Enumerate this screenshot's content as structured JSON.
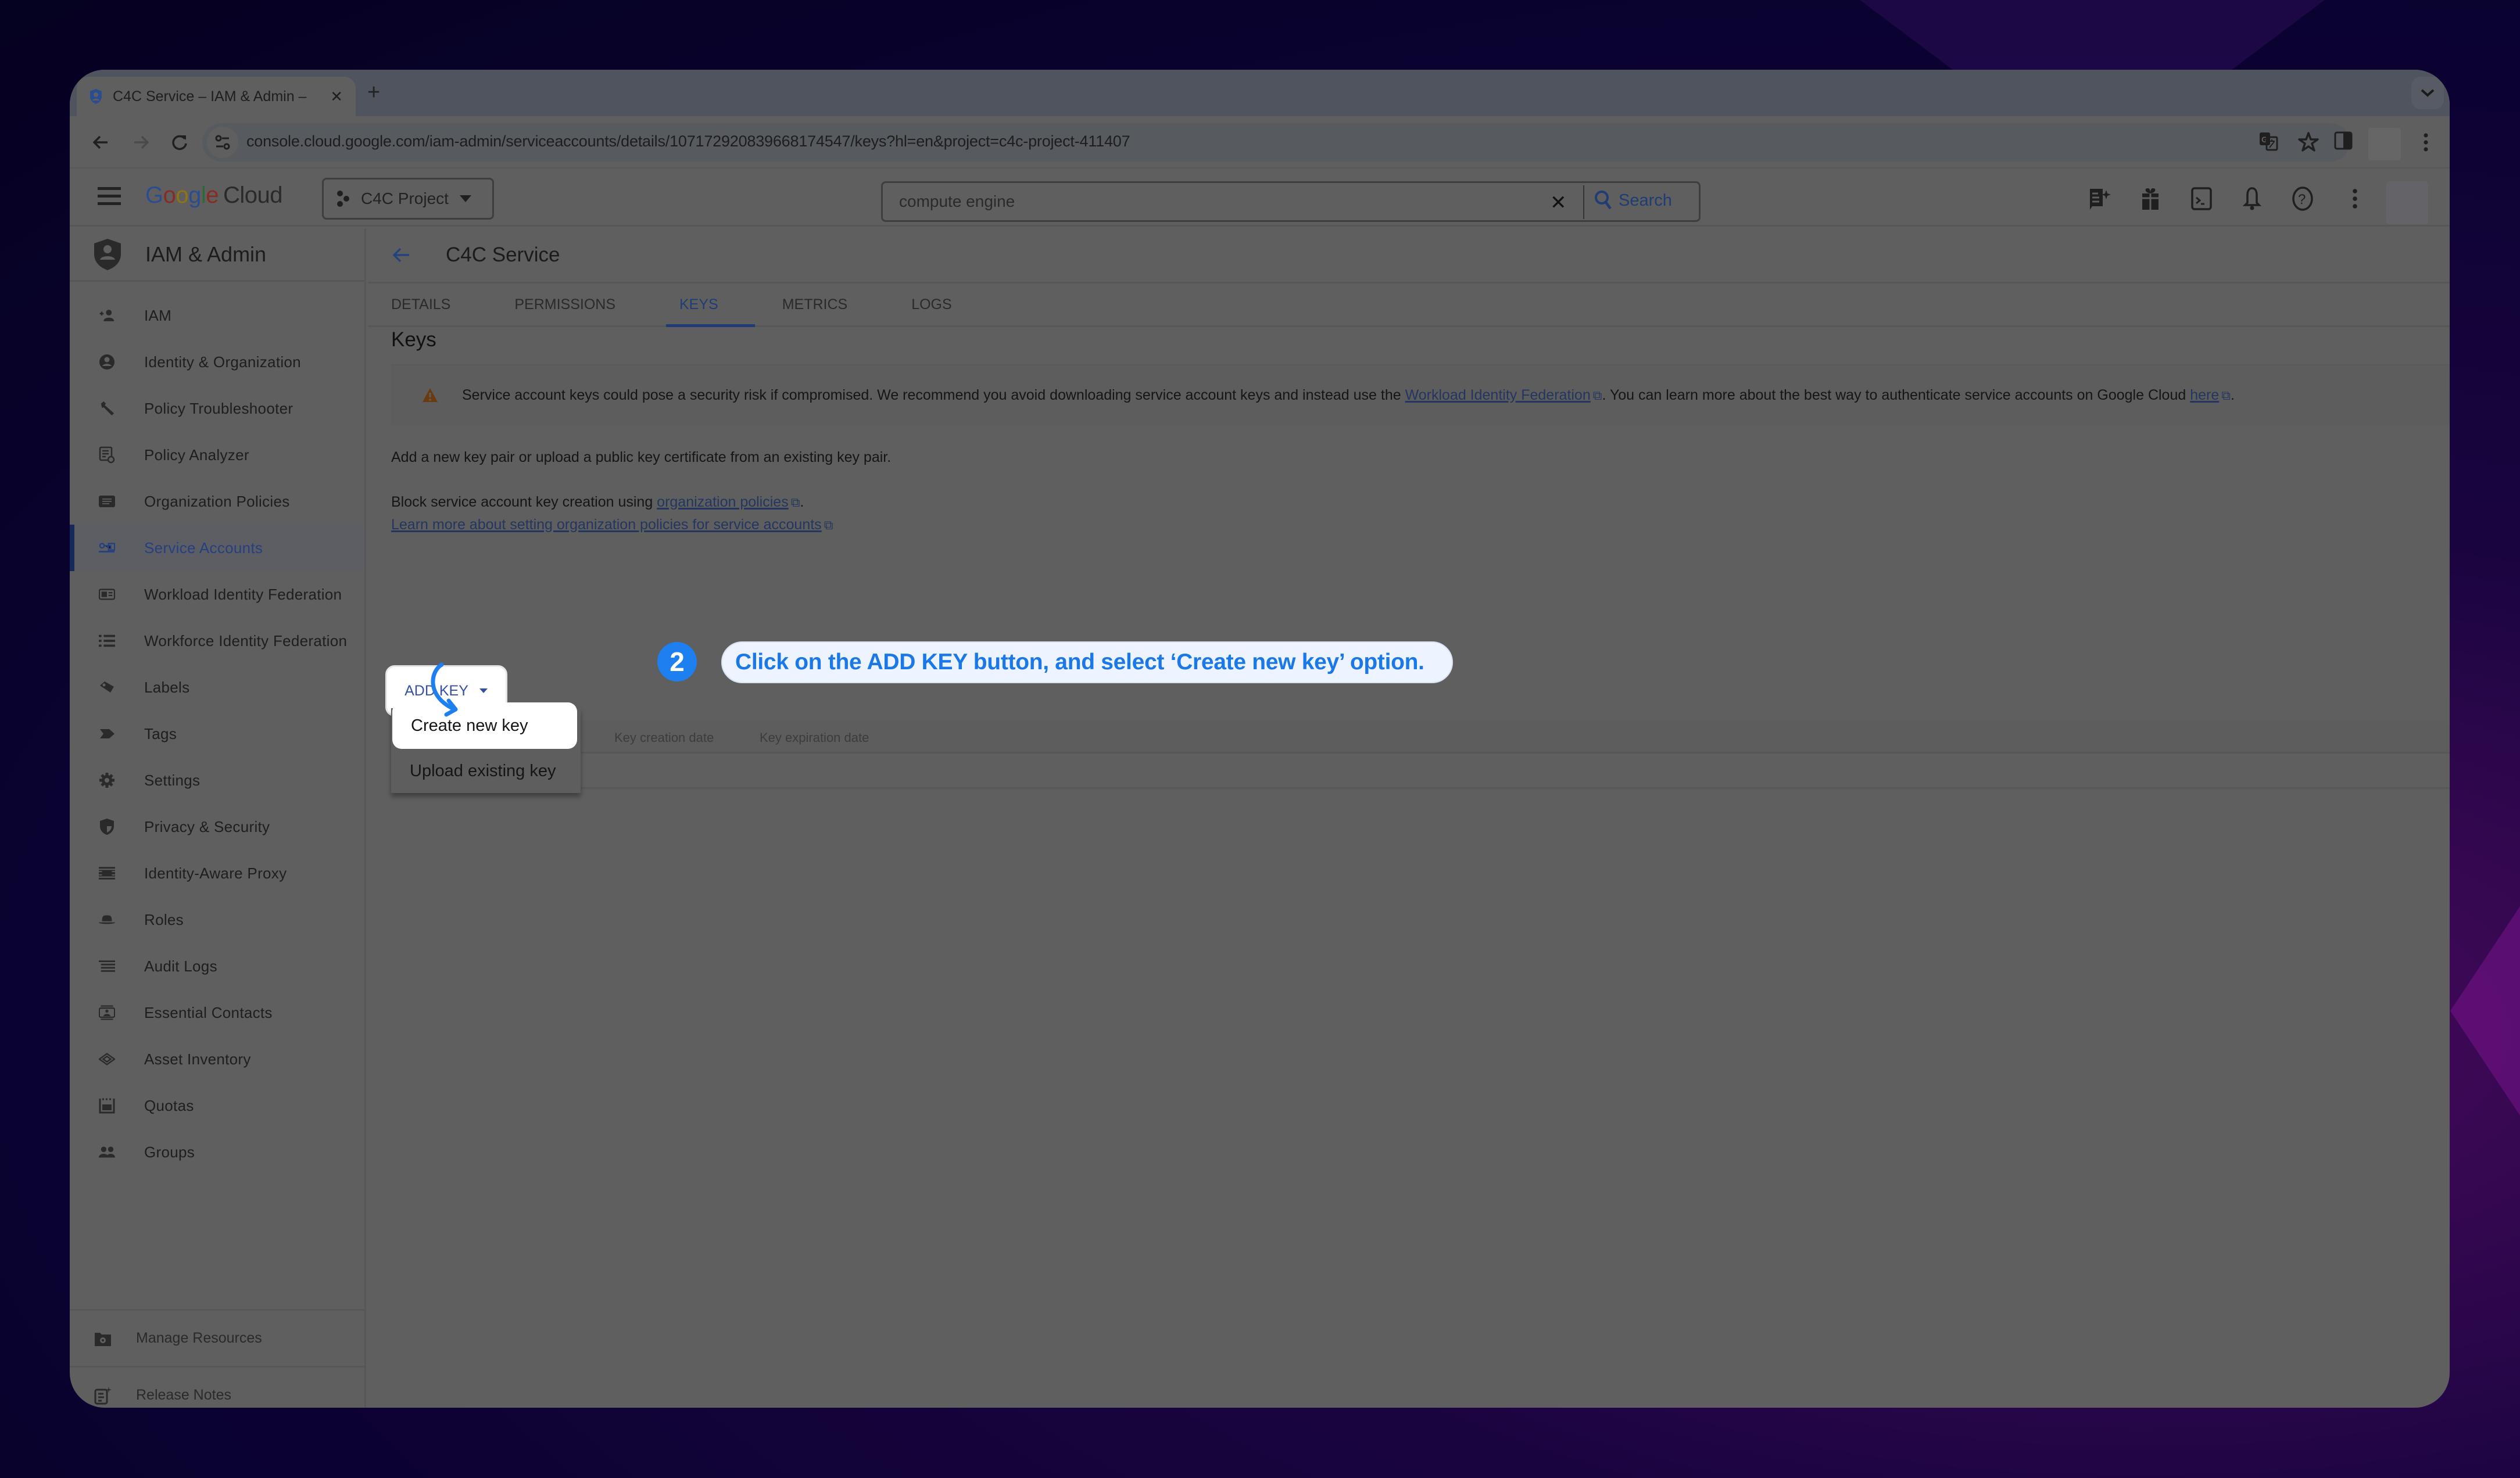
{
  "browser": {
    "tab_title": "C4C Service – IAM & Admin –",
    "url": "console.cloud.google.com/iam-admin/serviceaccounts/details/107172920839668174547/keys?hl=en&project=c4c-project-411407"
  },
  "header": {
    "logo_google": [
      "G",
      "o",
      "o",
      "g",
      "l",
      "e"
    ],
    "logo_cloud": "Cloud",
    "project": "C4C Project",
    "search_value": "compute engine",
    "search_button": "Search"
  },
  "sidebar": {
    "title": "IAM & Admin",
    "items": [
      {
        "label": "IAM",
        "icon": "person-add-icon"
      },
      {
        "label": "Identity & Organization",
        "icon": "account-circle-icon"
      },
      {
        "label": "Policy Troubleshooter",
        "icon": "wrench-icon"
      },
      {
        "label": "Policy Analyzer",
        "icon": "policy-analyzer-icon"
      },
      {
        "label": "Organization Policies",
        "icon": "org-policy-icon"
      },
      {
        "label": "Service Accounts",
        "icon": "service-account-key-icon",
        "active": true
      },
      {
        "label": "Workload Identity Federation",
        "icon": "id-card-icon"
      },
      {
        "label": "Workforce Identity Federation",
        "icon": "list-icon"
      },
      {
        "label": "Labels",
        "icon": "label-icon"
      },
      {
        "label": "Tags",
        "icon": "tag-icon"
      },
      {
        "label": "Settings",
        "icon": "gear-icon"
      },
      {
        "label": "Privacy & Security",
        "icon": "shield-icon"
      },
      {
        "label": "Identity-Aware Proxy",
        "icon": "proxy-icon"
      },
      {
        "label": "Roles",
        "icon": "hat-icon"
      },
      {
        "label": "Audit Logs",
        "icon": "audit-lines-icon"
      },
      {
        "label": "Essential Contacts",
        "icon": "contact-icon"
      },
      {
        "label": "Asset Inventory",
        "icon": "layers-icon"
      },
      {
        "label": "Quotas",
        "icon": "quota-icon"
      },
      {
        "label": "Groups",
        "icon": "group-icon"
      }
    ],
    "bottom": [
      {
        "label": "Manage Resources",
        "icon": "folder-gear-icon"
      },
      {
        "label": "Release Notes",
        "icon": "release-notes-icon"
      }
    ]
  },
  "main": {
    "page_title": "C4C Service",
    "tabs": [
      {
        "label": "DETAILS"
      },
      {
        "label": "PERMISSIONS"
      },
      {
        "label": "KEYS",
        "active": true
      },
      {
        "label": "METRICS"
      },
      {
        "label": "LOGS"
      }
    ],
    "section_title": "Keys",
    "banner": {
      "text_before": "Service account keys could pose a security risk if compromised. We recommend you avoid downloading service account keys and instead use the ",
      "link1": "Workload Identity Federation",
      "text_mid": ". You can learn more about the best way to authenticate service accounts on Google Cloud ",
      "link2": "here",
      "text_end": "."
    },
    "intro": "Add a new key pair or upload a public key certificate from an existing key pair.",
    "block_text": "Block service account key creation using ",
    "block_link": "organization policies",
    "learn_more_link": "Learn more about setting organization policies for service accounts",
    "add_key_label": "ADD KEY",
    "dropdown": [
      "Create new key",
      "Upload existing key"
    ],
    "table_headers": [
      "Key creation date",
      "Key expiration date"
    ]
  },
  "tutorial": {
    "step": "2",
    "text": "Click on the ADD KEY button, and select ‘Create new key’ option.",
    "accent": "#1a78e8"
  }
}
